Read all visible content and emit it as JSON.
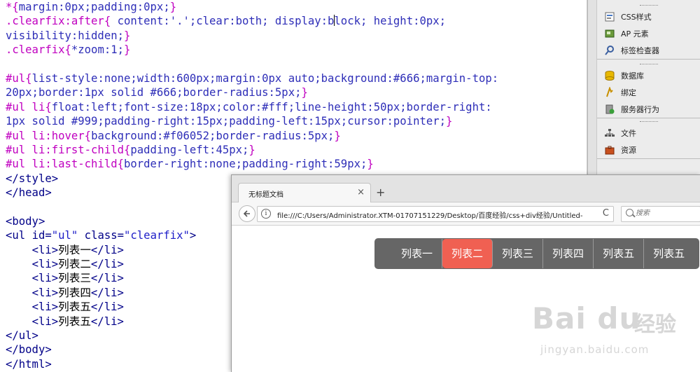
{
  "editor": {
    "lines": [
      [
        {
          "t": "*{",
          "c": "sel"
        },
        {
          "t": "margin:0px;padding:0px;",
          "c": "prop"
        },
        {
          "t": "}",
          "c": "sel"
        }
      ],
      [
        {
          "t": ".clearfix:after{ ",
          "c": "sel"
        },
        {
          "t": "content:'.';clear:both; display:b",
          "c": "prop"
        },
        {
          "caret": true
        },
        {
          "t": "lock; height:0px;",
          "c": "prop"
        }
      ],
      [
        {
          "t": "visibility:hidden;",
          "c": "prop"
        },
        {
          "t": "}",
          "c": "sel"
        }
      ],
      [
        {
          "t": ".clearfix{",
          "c": "sel"
        },
        {
          "t": "*zoom:1;",
          "c": "prop"
        },
        {
          "t": "}",
          "c": "sel"
        }
      ],
      [],
      [
        {
          "t": "#ul{",
          "c": "sel"
        },
        {
          "t": "list-style:none;width:600px;margin:0px auto;background:#666;margin-top:",
          "c": "prop"
        }
      ],
      [
        {
          "t": "20px;border:1px solid #666;border-radius:5px;",
          "c": "prop"
        },
        {
          "t": "}",
          "c": "sel"
        }
      ],
      [
        {
          "t": "#ul li{",
          "c": "sel"
        },
        {
          "t": "float:left;font-size:18px;color:#fff;line-height:50px;border-right:",
          "c": "prop"
        }
      ],
      [
        {
          "t": "1px solid #999;padding-right:15px;padding-left:15px;cursor:pointer;",
          "c": "prop"
        },
        {
          "t": "}",
          "c": "sel"
        }
      ],
      [
        {
          "t": "#ul li:hover{",
          "c": "sel"
        },
        {
          "t": "background:#f06052;border-radius:5px;",
          "c": "prop"
        },
        {
          "t": "}",
          "c": "sel"
        }
      ],
      [
        {
          "t": "#ul li:first-child{",
          "c": "sel"
        },
        {
          "t": "padding-left:45px;",
          "c": "prop"
        },
        {
          "t": "}",
          "c": "sel"
        }
      ],
      [
        {
          "t": "#ul li:last-child{",
          "c": "sel"
        },
        {
          "t": "border-right:none;padding-right:59px;",
          "c": "prop"
        },
        {
          "t": "}",
          "c": "sel"
        }
      ],
      [
        {
          "t": "</style>",
          "c": "tag"
        }
      ],
      [
        {
          "t": "</head>",
          "c": "tag"
        }
      ],
      [],
      [
        {
          "t": "<body>",
          "c": "tag"
        }
      ],
      [
        {
          "t": "<ul ",
          "c": "tag"
        },
        {
          "t": "id=",
          "c": "attr"
        },
        {
          "t": "\"ul\"",
          "c": "str"
        },
        {
          "t": " class=",
          "c": "attr"
        },
        {
          "t": "\"clearfix\"",
          "c": "str"
        },
        {
          "t": ">",
          "c": "tag"
        }
      ],
      [
        {
          "t": "    ",
          "c": "txt"
        },
        {
          "t": "<li>",
          "c": "tag"
        },
        {
          "t": "列表一",
          "c": "txt"
        },
        {
          "t": "</li>",
          "c": "tag"
        }
      ],
      [
        {
          "t": "    ",
          "c": "txt"
        },
        {
          "t": "<li>",
          "c": "tag"
        },
        {
          "t": "列表二",
          "c": "txt"
        },
        {
          "t": "</li>",
          "c": "tag"
        }
      ],
      [
        {
          "t": "    ",
          "c": "txt"
        },
        {
          "t": "<li>",
          "c": "tag"
        },
        {
          "t": "列表三",
          "c": "txt"
        },
        {
          "t": "</li>",
          "c": "tag"
        }
      ],
      [
        {
          "t": "    ",
          "c": "txt"
        },
        {
          "t": "<li>",
          "c": "tag"
        },
        {
          "t": "列表四",
          "c": "txt"
        },
        {
          "t": "</li>",
          "c": "tag"
        }
      ],
      [
        {
          "t": "    ",
          "c": "txt"
        },
        {
          "t": "<li>",
          "c": "tag"
        },
        {
          "t": "列表五",
          "c": "txt"
        },
        {
          "t": "</li>",
          "c": "tag"
        }
      ],
      [
        {
          "t": "    ",
          "c": "txt"
        },
        {
          "t": "<li>",
          "c": "tag"
        },
        {
          "t": "列表五",
          "c": "txt"
        },
        {
          "t": "</li>",
          "c": "tag"
        }
      ],
      [
        {
          "t": "</ul>",
          "c": "tag"
        }
      ],
      [
        {
          "t": "</body>",
          "c": "tag"
        }
      ],
      [
        {
          "t": "</html>",
          "c": "tag"
        }
      ]
    ]
  },
  "panel": {
    "group1": [
      {
        "label": "CSS样式",
        "icon": "css-styles-icon"
      },
      {
        "label": "AP 元素",
        "icon": "ap-elements-icon"
      },
      {
        "label": "标签检查器",
        "icon": "tag-inspector-icon"
      }
    ],
    "group2": [
      {
        "label": "数据库",
        "icon": "database-icon"
      },
      {
        "label": "绑定",
        "icon": "bindings-icon"
      },
      {
        "label": "服务器行为",
        "icon": "server-behaviors-icon"
      }
    ],
    "group3": [
      {
        "label": "文件",
        "icon": "files-icon"
      },
      {
        "label": "资源",
        "icon": "assets-icon"
      }
    ]
  },
  "browser": {
    "tab_title": "无标题文档",
    "tab_close": "×",
    "new_tab": "+",
    "url": "file:///C:/Users/Administrator.XTM-01707151229/Desktop/百度经验/css+div经验/Untitled-",
    "reload": "C",
    "search_placeholder": "搜索",
    "menu": {
      "items": [
        "列表一",
        "列表二",
        "列表三",
        "列表四",
        "列表五",
        "列表五"
      ],
      "active_index": 1,
      "background": "#666666",
      "hover_color": "#f06052"
    }
  },
  "watermark": {
    "logo": "Bai du",
    "cn": "经验",
    "url": "jingyan.baidu.com"
  }
}
